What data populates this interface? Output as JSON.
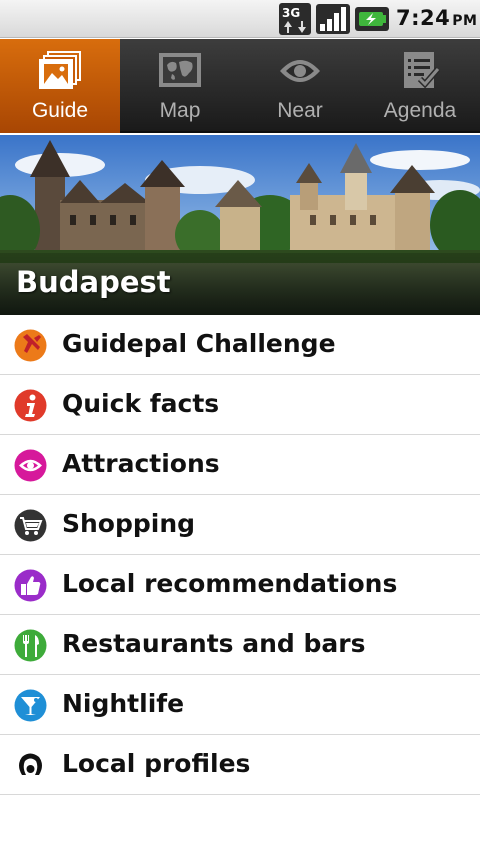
{
  "status_bar": {
    "time": "7:24",
    "ampm": "PM",
    "network_icon": "3g-icon",
    "signal_icon": "signal-icon",
    "battery_icon": "battery-charging-icon"
  },
  "tabs": [
    {
      "label": "Guide",
      "icon": "guide-icon",
      "active": true
    },
    {
      "label": "Map",
      "icon": "map-icon",
      "active": false
    },
    {
      "label": "Near",
      "icon": "eye-icon",
      "active": false
    },
    {
      "label": "Agenda",
      "icon": "agenda-icon",
      "active": false
    }
  ],
  "banner": {
    "city": "Budapest"
  },
  "menu": [
    {
      "label": "Guidepal Challenge",
      "icon": "challenge-icon",
      "color": "#e8771a"
    },
    {
      "label": "Quick facts",
      "icon": "info-icon",
      "color": "#e03a2a"
    },
    {
      "label": "Attractions",
      "icon": "eye-icon",
      "color": "#d6199b"
    },
    {
      "label": "Shopping",
      "icon": "cart-icon",
      "color": "#333333"
    },
    {
      "label": "Local recommendations",
      "icon": "thumbs-up-icon",
      "color": "#9a2cc9"
    },
    {
      "label": "Restaurants and bars",
      "icon": "cutlery-icon",
      "color": "#3eab3a"
    },
    {
      "label": "Nightlife",
      "icon": "cocktail-icon",
      "color": "#1f8fd6"
    },
    {
      "label": "Local profiles",
      "icon": "profile-icon",
      "color": "#111111"
    }
  ],
  "colors": {
    "active_tab": "#d86d0d",
    "tab_bar": "#2a2a2a"
  }
}
